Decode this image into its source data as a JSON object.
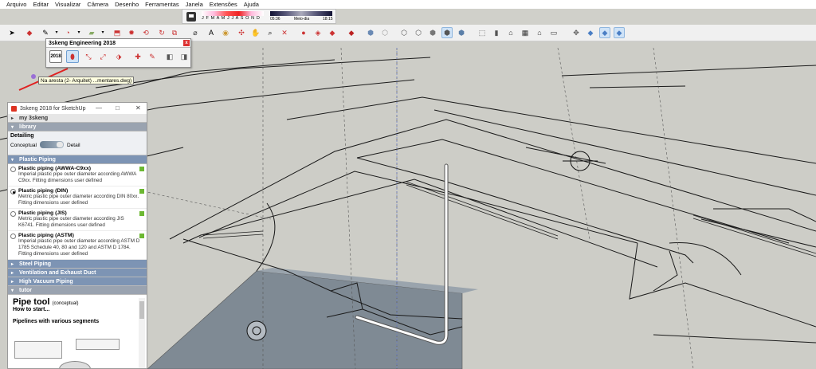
{
  "menu": [
    "Arquivo",
    "Editar",
    "Visualizar",
    "Câmera",
    "Desenho",
    "Ferramentas",
    "Janela",
    "Extensões",
    "Ajuda"
  ],
  "shadow": {
    "months": "J F M A M J J A S O N D",
    "time_start": "05:36",
    "time_mid": "Meio-dia",
    "time_end": "18:15"
  },
  "engineering_toolbar": {
    "title": "3skeng Engineering 2018",
    "version_badge": "2018",
    "close": "x"
  },
  "tooltip": "Na aresta (2- Arquitet) ...mentares.dwg)",
  "panel": {
    "title": "3skeng 2018 for SketchUp",
    "minimize": "—",
    "maximize": "□",
    "close": "✕",
    "sections": {
      "my3skeng": "my 3skeng",
      "library": "library",
      "plastic": "Plastic Piping",
      "steel": "Steel Piping",
      "ventilation": "Ventilation and Exhaust Duct",
      "vacuum": "High Vacuum Piping",
      "tutor": "tutor"
    },
    "detailing": {
      "heading": "Detailing",
      "left": "Conceptual",
      "right": "Detail"
    },
    "options": [
      {
        "title": "Plastic piping (AWWA-C9xx)",
        "desc": "Imperial plastic pipe outer diameter according AWWA C9xx. Fitting dimensions user defined"
      },
      {
        "title": "Plastic piping (DIN)",
        "desc": "Metric plastic pipe outer diameter according DIN 80xx. Fitting dimensions user defined"
      },
      {
        "title": "Plastic piping (JIS)",
        "desc": "Metric plastic pipe outer diameter according JIS K6741. Fitting dimensions user defined"
      },
      {
        "title": "Plastic piping (ASTM)",
        "desc": "Imperial plastic pipe outer diameter according ASTM D 1785 Schedule 40, 80 and 120 and ASTM D 1784. Fitting dimensions user defined"
      }
    ],
    "tutor": {
      "title": "Pipe tool",
      "subtitle": "(conceptual)",
      "how": "How to start...",
      "pipelines": "Pipelines with various segments"
    }
  }
}
